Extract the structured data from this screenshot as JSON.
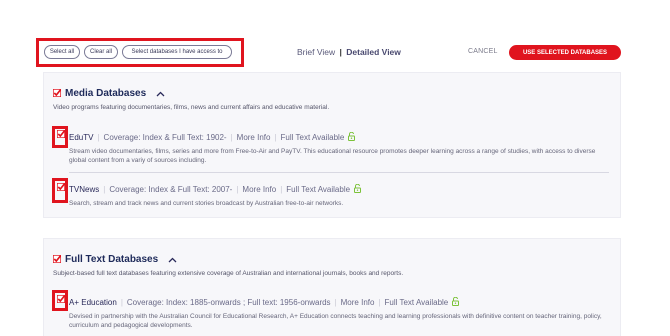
{
  "toolbar": {
    "select_all": "Select all",
    "clear_all": "Clear all",
    "select_access": "Select databases I have access to",
    "brief_view": "Brief View",
    "view_separator": "|",
    "detailed_view": "Detailed View",
    "cancel": "CANCEL",
    "use_selected": "USE SELECTED DATABASES"
  },
  "sections": [
    {
      "title": "Media Databases",
      "description": "Video programs featuring documentaries, films, news and current affairs and educative material.",
      "checked": true,
      "items": [
        {
          "name": "EduTV",
          "coverage": "Coverage: Index & Full Text: 1902-",
          "more_info": "More Info",
          "full_text": "Full Text Available",
          "description": "Stream video documentaries, films, series and more from Free-to-Air and PayTV. This educational resource promotes deeper learning across a range of studies, with access to diverse global content from a variy of sources including.",
          "checked": true
        },
        {
          "name": "TVNews",
          "coverage": "Coverage: Index & Full Text: 2007-",
          "more_info": "More Info",
          "full_text": "Full Text Available",
          "description": "Search, stream and track news and current stories broadcast by Australian free-to-air networks.",
          "checked": true
        }
      ]
    },
    {
      "title": "Full Text Databases",
      "description": "Subject-based full text databases featuring extensive coverage of Australian and international journals, books and reports.",
      "checked": true,
      "items": [
        {
          "name": "A+ Education",
          "coverage": "Coverage: Index: 1885-onwards ; Full text: 1956-onwards",
          "more_info": "More Info",
          "full_text": "Full Text Available",
          "description": "Devised in partnership with the Australian Council for Educational Research, A+ Education connects teaching and learning professionals with definitive content on teacher training, policy, curriculum and pedagogical developments.",
          "checked": true
        }
      ]
    }
  ],
  "colors": {
    "accent_red": "#e0141e",
    "heading_navy": "#1e2a5a",
    "lock_green": "#7cc23a",
    "panel_bg": "#f7f7fa"
  },
  "icons": {
    "checkbox": "checked-checkbox-icon",
    "collapse": "chevron-up-icon",
    "open_access": "open-lock-icon"
  }
}
